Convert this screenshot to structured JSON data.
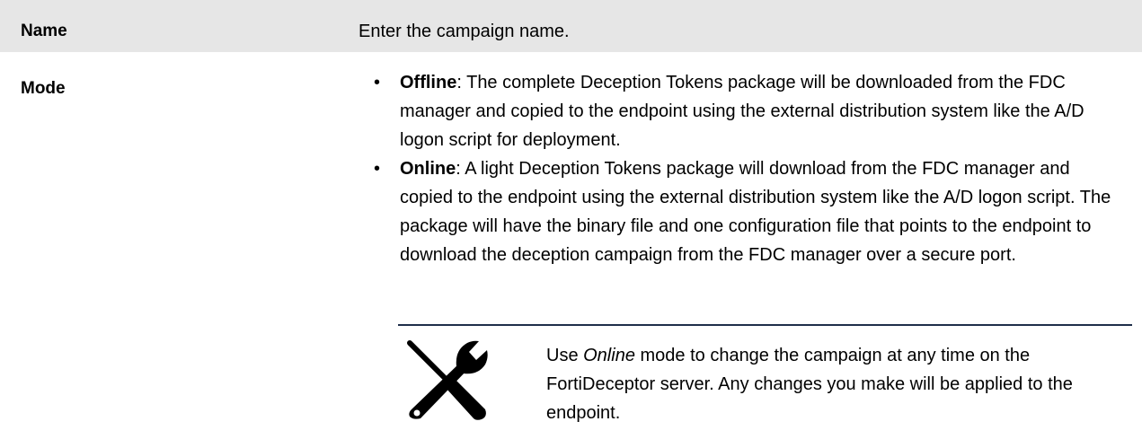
{
  "rows": {
    "name": {
      "label": "Name",
      "description": "Enter the campaign name."
    },
    "mode": {
      "label": "Mode",
      "options": [
        {
          "term": "Offline",
          "text": ": The complete Deception Tokens package will be downloaded from the FDC manager and copied to the endpoint using the external distribution system like the A/D logon script for deployment."
        },
        {
          "term": "Online",
          "text": ": A light Deception Tokens package will download from the FDC manager and copied to the endpoint using the external distribution system like the A/D logon script. The package will have the binary file and one configuration file that points to the endpoint to download the deception campaign from the FDC manager over a secure port."
        }
      ],
      "bullet": "•",
      "note": {
        "icon": "tools-icon",
        "prefix": "Use ",
        "emphasis": "Online",
        "suffix": " mode to change the campaign at any time on the FortiDeceptor server. Any changes you make will be applied to the endpoint."
      }
    }
  },
  "colors": {
    "row_shading": "#e6e6e6",
    "note_rule": "#1f2f4a",
    "text": "#000000"
  }
}
